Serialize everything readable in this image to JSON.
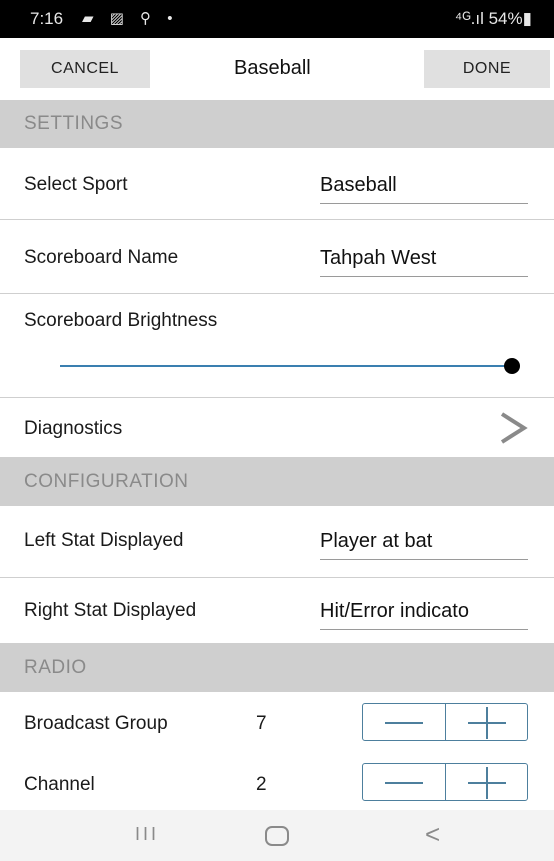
{
  "status_bar": {
    "time": "7:16",
    "left_icons": "▰ ▨ ⚲ •",
    "right_icons": "⁴ᴳ.ıl 54%▮"
  },
  "top_bar": {
    "cancel_label": "CANCEL",
    "title": "Baseball",
    "done_label": "DONE"
  },
  "sections": {
    "settings": "SETTINGS",
    "configuration": "CONFIGURATION",
    "radio": "RADIO"
  },
  "settings": {
    "select_sport_label": "Select Sport",
    "select_sport_value": "Baseball",
    "scoreboard_name_label": "Scoreboard Name",
    "scoreboard_name_value": "Tahpah West",
    "brightness_label": "Scoreboard Brightness",
    "brightness_level": 1.0,
    "diagnostics_label": "Diagnostics",
    "chevron_icon": "chevron-right-icon"
  },
  "configuration": {
    "left_stat_label": "Left Stat Displayed",
    "left_stat_value": "Player at bat",
    "right_stat_label": "Right Stat Displayed",
    "right_stat_value": "Hit/Error indicato"
  },
  "radio": {
    "broadcast_group_label": "Broadcast Group",
    "broadcast_group_value": "7",
    "channel_label": "Channel",
    "channel_value": "2"
  },
  "nav": {
    "recent_glyph": "III",
    "back_glyph": "<"
  },
  "colors": {
    "section_bg": "#cfcfcf",
    "accent": "#3a7fb0",
    "stepper": "#4d7f9d"
  }
}
